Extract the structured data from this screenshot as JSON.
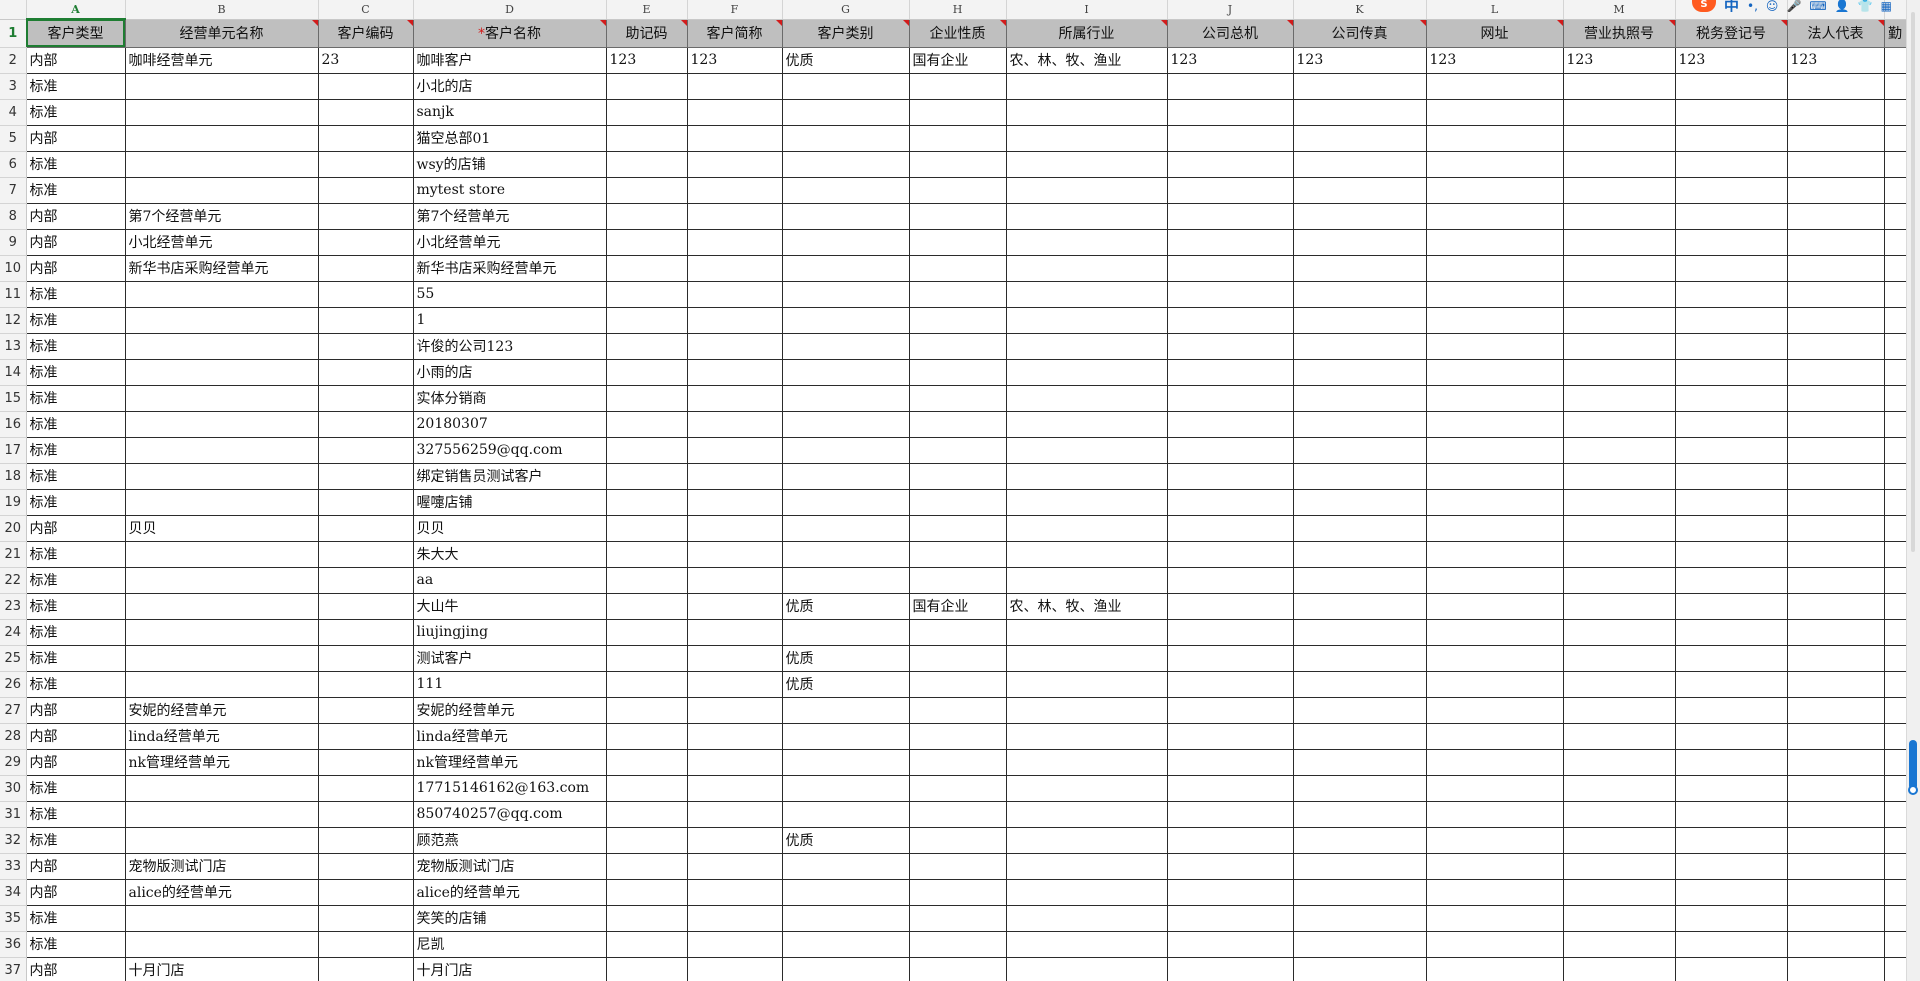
{
  "columns": [
    {
      "letter": "A",
      "header": "客户类型",
      "required": false,
      "active": true
    },
    {
      "letter": "B",
      "header": "经营单元名称",
      "required": false
    },
    {
      "letter": "C",
      "header": "客户编码",
      "required": false
    },
    {
      "letter": "D",
      "header": "客户名称",
      "required": true
    },
    {
      "letter": "E",
      "header": "助记码",
      "required": false
    },
    {
      "letter": "F",
      "header": "客户简称",
      "required": false
    },
    {
      "letter": "G",
      "header": "客户类别",
      "required": false
    },
    {
      "letter": "H",
      "header": "企业性质",
      "required": false
    },
    {
      "letter": "I",
      "header": "所属行业",
      "required": false
    },
    {
      "letter": "J",
      "header": "公司总机",
      "required": false
    },
    {
      "letter": "K",
      "header": "公司传真",
      "required": false
    },
    {
      "letter": "L",
      "header": "网址",
      "required": false
    },
    {
      "letter": "M",
      "header": "营业执照号",
      "required": false
    },
    {
      "letter": "",
      "header": "税务登记号",
      "required": false
    },
    {
      "letter": "",
      "header": "法人代表",
      "required": false
    },
    {
      "letter": "",
      "header": "勤",
      "required": false
    }
  ],
  "rows": [
    {
      "num": "2",
      "cells": [
        "内部",
        "咖啡经营单元",
        "23",
        "咖啡客户",
        "123",
        "123",
        "优质",
        "国有企业",
        "农、林、牧、渔业",
        "123",
        "123",
        "123",
        "123",
        "123",
        "123",
        ""
      ]
    },
    {
      "num": "3",
      "cells": [
        "标准",
        "",
        "",
        "小北的店",
        "",
        "",
        "",
        "",
        "",
        "",
        "",
        "",
        "",
        "",
        "",
        ""
      ]
    },
    {
      "num": "4",
      "cells": [
        "标准",
        "",
        "",
        "sanjk",
        "",
        "",
        "",
        "",
        "",
        "",
        "",
        "",
        "",
        "",
        "",
        ""
      ]
    },
    {
      "num": "5",
      "cells": [
        "内部",
        "",
        "",
        "猫空总部01",
        "",
        "",
        "",
        "",
        "",
        "",
        "",
        "",
        "",
        "",
        "",
        ""
      ]
    },
    {
      "num": "6",
      "cells": [
        "标准",
        "",
        "",
        "wsy的店铺",
        "",
        "",
        "",
        "",
        "",
        "",
        "",
        "",
        "",
        "",
        "",
        ""
      ]
    },
    {
      "num": "7",
      "cells": [
        "标准",
        "",
        "",
        "mytest store",
        "",
        "",
        "",
        "",
        "",
        "",
        "",
        "",
        "",
        "",
        "",
        ""
      ]
    },
    {
      "num": "8",
      "cells": [
        "内部",
        "第7个经营单元",
        "",
        "第7个经营单元",
        "",
        "",
        "",
        "",
        "",
        "",
        "",
        "",
        "",
        "",
        "",
        ""
      ]
    },
    {
      "num": "9",
      "cells": [
        "内部",
        "小北经营单元",
        "",
        "小北经营单元",
        "",
        "",
        "",
        "",
        "",
        "",
        "",
        "",
        "",
        "",
        "",
        ""
      ]
    },
    {
      "num": "10",
      "cells": [
        "内部",
        "新华书店采购经营单元",
        "",
        "新华书店采购经营单元",
        "",
        "",
        "",
        "",
        "",
        "",
        "",
        "",
        "",
        "",
        "",
        ""
      ]
    },
    {
      "num": "11",
      "cells": [
        "标准",
        "",
        "",
        "55",
        "",
        "",
        "",
        "",
        "",
        "",
        "",
        "",
        "",
        "",
        "",
        ""
      ]
    },
    {
      "num": "12",
      "cells": [
        "标准",
        "",
        "",
        "1",
        "",
        "",
        "",
        "",
        "",
        "",
        "",
        "",
        "",
        "",
        "",
        ""
      ]
    },
    {
      "num": "13",
      "cells": [
        "标准",
        "",
        "",
        "许俊的公司123",
        "",
        "",
        "",
        "",
        "",
        "",
        "",
        "",
        "",
        "",
        "",
        ""
      ]
    },
    {
      "num": "14",
      "cells": [
        "标准",
        "",
        "",
        "小雨的店",
        "",
        "",
        "",
        "",
        "",
        "",
        "",
        "",
        "",
        "",
        "",
        ""
      ]
    },
    {
      "num": "15",
      "cells": [
        "标准",
        "",
        "",
        "实体分销商",
        "",
        "",
        "",
        "",
        "",
        "",
        "",
        "",
        "",
        "",
        "",
        ""
      ]
    },
    {
      "num": "16",
      "cells": [
        "标准",
        "",
        "",
        "20180307",
        "",
        "",
        "",
        "",
        "",
        "",
        "",
        "",
        "",
        "",
        "",
        ""
      ]
    },
    {
      "num": "17",
      "cells": [
        "标准",
        "",
        "",
        "327556259@qq.com",
        "",
        "",
        "",
        "",
        "",
        "",
        "",
        "",
        "",
        "",
        "",
        ""
      ]
    },
    {
      "num": "18",
      "cells": [
        "标准",
        "",
        "",
        "绑定销售员测试客户",
        "",
        "",
        "",
        "",
        "",
        "",
        "",
        "",
        "",
        "",
        "",
        ""
      ]
    },
    {
      "num": "19",
      "cells": [
        "标准",
        "",
        "",
        "喔嚏店铺",
        "",
        "",
        "",
        "",
        "",
        "",
        "",
        "",
        "",
        "",
        "",
        ""
      ]
    },
    {
      "num": "20",
      "cells": [
        "内部",
        "贝贝",
        "",
        "贝贝",
        "",
        "",
        "",
        "",
        "",
        "",
        "",
        "",
        "",
        "",
        "",
        ""
      ]
    },
    {
      "num": "21",
      "cells": [
        "标准",
        "",
        "",
        "朱大大",
        "",
        "",
        "",
        "",
        "",
        "",
        "",
        "",
        "",
        "",
        "",
        ""
      ]
    },
    {
      "num": "22",
      "cells": [
        "标准",
        "",
        "",
        "aa",
        "",
        "",
        "",
        "",
        "",
        "",
        "",
        "",
        "",
        "",
        "",
        ""
      ]
    },
    {
      "num": "23",
      "cells": [
        "标准",
        "",
        "",
        "大山牛",
        "",
        "",
        "优质",
        "国有企业",
        "农、林、牧、渔业",
        "",
        "",
        "",
        "",
        "",
        "",
        ""
      ]
    },
    {
      "num": "24",
      "cells": [
        "标准",
        "",
        "",
        "liujingjing",
        "",
        "",
        "",
        "",
        "",
        "",
        "",
        "",
        "",
        "",
        "",
        ""
      ]
    },
    {
      "num": "25",
      "cells": [
        "标准",
        "",
        "",
        "测试客户",
        "",
        "",
        "优质",
        "",
        "",
        "",
        "",
        "",
        "",
        "",
        "",
        ""
      ]
    },
    {
      "num": "26",
      "cells": [
        "标准",
        "",
        "",
        "111",
        "",
        "",
        "优质",
        "",
        "",
        "",
        "",
        "",
        "",
        "",
        "",
        ""
      ]
    },
    {
      "num": "27",
      "cells": [
        "内部",
        "安妮的经营单元",
        "",
        "安妮的经营单元",
        "",
        "",
        "",
        "",
        "",
        "",
        "",
        "",
        "",
        "",
        "",
        ""
      ]
    },
    {
      "num": "28",
      "cells": [
        "内部",
        "linda经营单元",
        "",
        "linda经营单元",
        "",
        "",
        "",
        "",
        "",
        "",
        "",
        "",
        "",
        "",
        "",
        ""
      ]
    },
    {
      "num": "29",
      "cells": [
        "内部",
        "nk管理经营单元",
        "",
        "nk管理经营单元",
        "",
        "",
        "",
        "",
        "",
        "",
        "",
        "",
        "",
        "",
        "",
        ""
      ]
    },
    {
      "num": "30",
      "cells": [
        "标准",
        "",
        "",
        "17715146162@163.com",
        "",
        "",
        "",
        "",
        "",
        "",
        "",
        "",
        "",
        "",
        "",
        ""
      ]
    },
    {
      "num": "31",
      "cells": [
        "标准",
        "",
        "",
        "850740257@qq.com",
        "",
        "",
        "",
        "",
        "",
        "",
        "",
        "",
        "",
        "",
        "",
        ""
      ]
    },
    {
      "num": "32",
      "cells": [
        "标准",
        "",
        "",
        "顾范燕",
        "",
        "",
        "优质",
        "",
        "",
        "",
        "",
        "",
        "",
        "",
        "",
        ""
      ]
    },
    {
      "num": "33",
      "cells": [
        "内部",
        "宠物版测试门店",
        "",
        "宠物版测试门店",
        "",
        "",
        "",
        "",
        "",
        "",
        "",
        "",
        "",
        "",
        "",
        ""
      ]
    },
    {
      "num": "34",
      "cells": [
        "内部",
        "alice的经营单元",
        "",
        "alice的经营单元",
        "",
        "",
        "",
        "",
        "",
        "",
        "",
        "",
        "",
        "",
        "",
        ""
      ]
    },
    {
      "num": "35",
      "cells": [
        "标准",
        "",
        "",
        "笑笑的店铺",
        "",
        "",
        "",
        "",
        "",
        "",
        "",
        "",
        "",
        "",
        "",
        ""
      ]
    },
    {
      "num": "36",
      "cells": [
        "标准",
        "",
        "",
        "尼凯",
        "",
        "",
        "",
        "",
        "",
        "",
        "",
        "",
        "",
        "",
        "",
        ""
      ]
    },
    {
      "num": "37",
      "cells": [
        "内部",
        "十月门店",
        "",
        "十月门店",
        "",
        "",
        "",
        "",
        "",
        "",
        "",
        "",
        "",
        "",
        "",
        ""
      ]
    }
  ],
  "header_row_num": "1",
  "ime": {
    "logo": "S",
    "lang": "中"
  },
  "colors": {
    "note_marker": "#d21b1b",
    "active": "#1e7d32",
    "header_bg": "#bfbfbf",
    "scroll_thumb": "#1976d2"
  }
}
